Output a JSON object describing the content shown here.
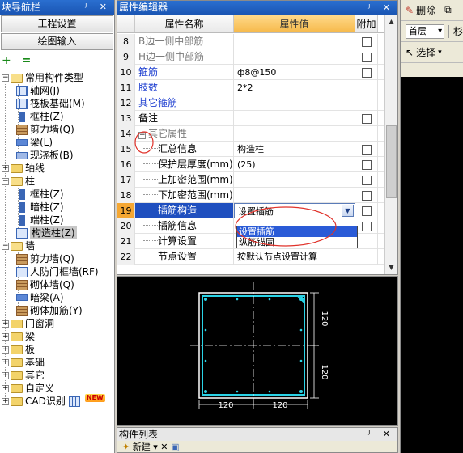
{
  "nav": {
    "title": "块导航栏",
    "title_icons": "ᴶ ✕",
    "btn_settings": "工程设置",
    "btn_draw": "绘图输入",
    "tools": "+ =",
    "tree": {
      "common": "常用构件类型",
      "axis_net": "轴网(J)",
      "raft": "筏板基础(M)",
      "frame_col": "框柱(Z)",
      "shear_wall": "剪力墙(Q)",
      "beam": "梁(L)",
      "cast_slab": "现浇板(B)",
      "axis": "轴线",
      "column": "柱",
      "col_frame": "框柱(Z)",
      "col_hidden": "暗柱(Z)",
      "col_end": "端柱(Z)",
      "col_struct": "构造柱(Z)",
      "wall": "墙",
      "wall_shear": "剪力墙(Q)",
      "wall_civil": "人防门框墙(RF)",
      "wall_brick": "砌体墙(Q)",
      "wall_beam": "暗梁(A)",
      "wall_rebar": "砌体加筋(Y)",
      "door": "门窗洞",
      "beam2": "梁",
      "slab": "板",
      "foundation": "基础",
      "other": "其它",
      "custom": "自定义",
      "cad": "CAD识别",
      "cad_new": "NEW"
    }
  },
  "props": {
    "title": "属性编辑器",
    "title_icons": "ᴶ ✕",
    "headers": {
      "name": "属性名称",
      "value": "属性值",
      "add": "附加"
    },
    "rows": [
      {
        "num": "8",
        "name": "B边一侧中部筋",
        "value": "",
        "cb": true
      },
      {
        "num": "9",
        "name": "H边一侧中部筋",
        "value": "",
        "cb": true
      },
      {
        "num": "10",
        "name": "箍筋",
        "value": "ф8@150",
        "cb": true
      },
      {
        "num": "11",
        "name": "肢数",
        "value": "2*2",
        "cb": false
      },
      {
        "num": "12",
        "name": "其它箍筋",
        "value": "",
        "cb": false
      },
      {
        "num": "13",
        "name": "备注",
        "value": "",
        "cb": true
      },
      {
        "num": "14",
        "name": "其它属性",
        "value": "",
        "cb": false
      },
      {
        "num": "15",
        "name": "汇总信息",
        "value": "构造柱",
        "cb": true
      },
      {
        "num": "16",
        "name": "保护层厚度(mm)",
        "value": "(25)",
        "cb": true
      },
      {
        "num": "17",
        "name": "上加密范围(mm)",
        "value": "",
        "cb": true
      },
      {
        "num": "18",
        "name": "下加密范围(mm)",
        "value": "",
        "cb": true
      },
      {
        "num": "19",
        "name": "插筋构造",
        "value": "设置插筋",
        "cb": true
      },
      {
        "num": "20",
        "name": "插筋信息",
        "value": "",
        "cb": true
      },
      {
        "num": "21",
        "name": "计算设置",
        "value": "按默认计算设置计算",
        "cb": false
      },
      {
        "num": "22",
        "name": "节点设置",
        "value": "按默认节点设置计算",
        "cb": false
      }
    ],
    "dropdown": [
      "设置插筋",
      "纵筋锚固"
    ],
    "collapse_sign": "−"
  },
  "preview": {
    "dim_120a": "120",
    "dim_120b": "120",
    "dim_120c": "120",
    "dim_120d": "120"
  },
  "complist": {
    "title": "构件列表",
    "title_icons": "ᴶ ✕",
    "new_label": "新建"
  },
  "right": {
    "delete": "删除",
    "floor": "首层",
    "select": "选择"
  }
}
